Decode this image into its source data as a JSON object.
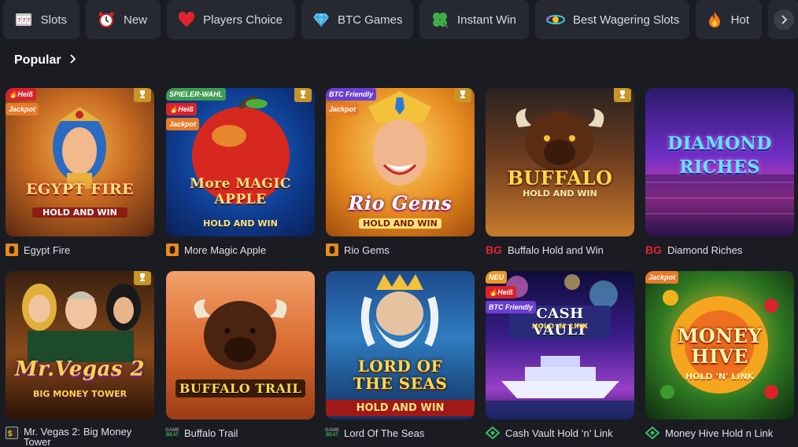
{
  "categories": [
    {
      "label": "Slots",
      "icon": "slot-machine-icon"
    },
    {
      "label": "New",
      "icon": "alarm-clock-icon"
    },
    {
      "label": "Players Choice",
      "icon": "heart-icon"
    },
    {
      "label": "BTC Games",
      "icon": "diamond-icon"
    },
    {
      "label": "Instant Win",
      "icon": "clover-icon"
    },
    {
      "label": "Best Wagering Slots",
      "icon": "orbit-icon"
    },
    {
      "label": "Hot",
      "icon": "flame-icon"
    }
  ],
  "section": {
    "title": "Popular"
  },
  "badges": {
    "hot": "Heiß",
    "jackpot": "Jackpot",
    "spieler": "SPIELER-WAHL",
    "btc": "BTC Friendly",
    "neu": "NEU"
  },
  "games": [
    {
      "name": "Egypt Fire",
      "provider": "bp",
      "art_title": "EGYPT FIRE",
      "art_sub": "HOLD AND WIN"
    },
    {
      "name": "More Magic Apple",
      "provider": "bp",
      "art_title": "More MAGIC APPLE",
      "art_sub": "HOLD AND WIN"
    },
    {
      "name": "Rio Gems",
      "provider": "bp",
      "art_title": "Rio Gems",
      "art_sub": "HOLD AND WIN"
    },
    {
      "name": "Buffalo Hold and Win",
      "provider": "BG",
      "art_title": "BUFFALO",
      "art_sub": "HOLD AND WIN"
    },
    {
      "name": "Diamond Riches",
      "provider": "BG",
      "art_title": "DIAMOND RICHES",
      "art_sub": ""
    },
    {
      "name": "Mr. Vegas 2: Big Money Tower",
      "provider": "bs",
      "art_title": "Mr.Vegas 2",
      "art_sub": "BIG MONEY TOWER"
    },
    {
      "name": "Buffalo Trail",
      "provider": "GAMEBEAT",
      "art_title": "BUFFALO TRAIL",
      "art_sub": ""
    },
    {
      "name": "Lord Of The Seas",
      "provider": "GAMEBEAT",
      "art_title": "LORD OF THE SEAS",
      "art_sub": "HOLD AND WIN"
    },
    {
      "name": "Cash Vault Hold ‘n’ Link",
      "provider": "gem",
      "art_title": "CASH VAULT",
      "art_sub": "HOLD 'N' LINK"
    },
    {
      "name": "Money Hive Hold n Link",
      "provider": "gem",
      "art_title": "MONEY HIVE",
      "art_sub": "HOLD 'N' LINK"
    }
  ]
}
